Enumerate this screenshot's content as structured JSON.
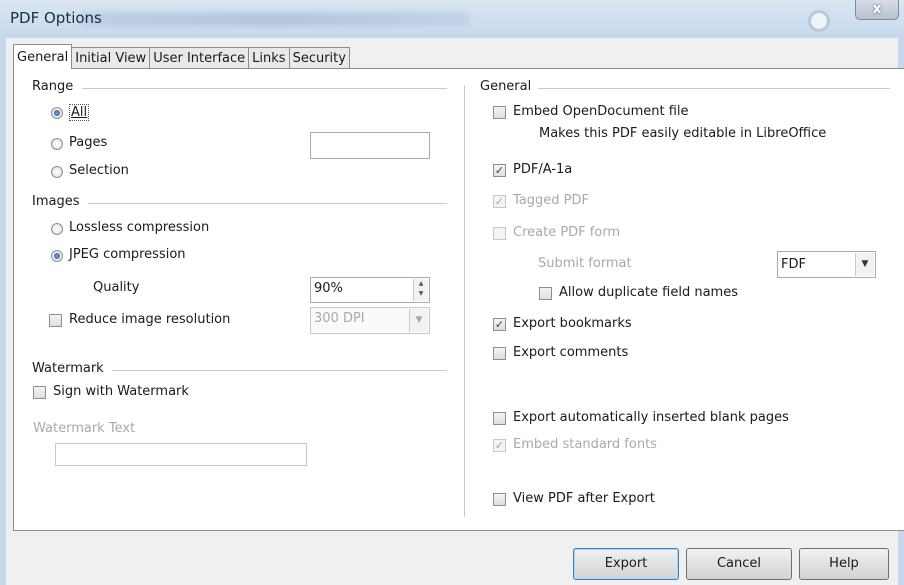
{
  "window": {
    "title": "PDF Options",
    "close_glyph": "x"
  },
  "tabs": [
    {
      "label": "General"
    },
    {
      "label": "Initial View"
    },
    {
      "label": "User Interface"
    },
    {
      "label": "Links"
    },
    {
      "label": "Security"
    }
  ],
  "range": {
    "heading": "Range",
    "all": "All",
    "pages": "Pages",
    "pages_value": "",
    "selection": "Selection",
    "selected": "All"
  },
  "images": {
    "heading": "Images",
    "lossless": "Lossless compression",
    "jpeg": "JPEG compression",
    "selected": "JPEG compression",
    "quality_label": "Quality",
    "quality_value": "90%",
    "reduce_label": "Reduce image resolution",
    "reduce_checked": false,
    "resolution_value": "300 DPI"
  },
  "watermark": {
    "heading": "Watermark",
    "sign_label": "Sign with Watermark",
    "sign_checked": false,
    "text_label": "Watermark Text",
    "text_value": ""
  },
  "general": {
    "heading": "General",
    "embed_odf": {
      "label": "Embed OpenDocument file",
      "checked": false
    },
    "embed_odf_note": "Makes this PDF easily editable in LibreOffice",
    "pdfa": {
      "label": "PDF/A-1a",
      "checked": true
    },
    "tagged": {
      "label": "Tagged PDF",
      "checked": true,
      "disabled": true
    },
    "create_form": {
      "label": "Create PDF form",
      "checked": false,
      "disabled": true
    },
    "submit_format_label": "Submit format",
    "submit_format_value": "FDF",
    "allow_duplicate": {
      "label": "Allow duplicate field names",
      "checked": false
    },
    "export_bookmarks": {
      "label": "Export bookmarks",
      "checked": true
    },
    "export_comments": {
      "label": "Export comments",
      "checked": false
    },
    "export_blank_pages": {
      "label": "Export automatically inserted blank pages",
      "checked": false
    },
    "embed_fonts": {
      "label": "Embed standard fonts",
      "checked": true,
      "disabled": true
    },
    "view_after": {
      "label": "View PDF after Export",
      "checked": false
    }
  },
  "buttons": {
    "export": "Export",
    "cancel": "Cancel",
    "help": "Help"
  },
  "icons": {
    "check": "✓",
    "spin_up": "▲",
    "spin_down": "▼",
    "dropdown": "▼"
  }
}
